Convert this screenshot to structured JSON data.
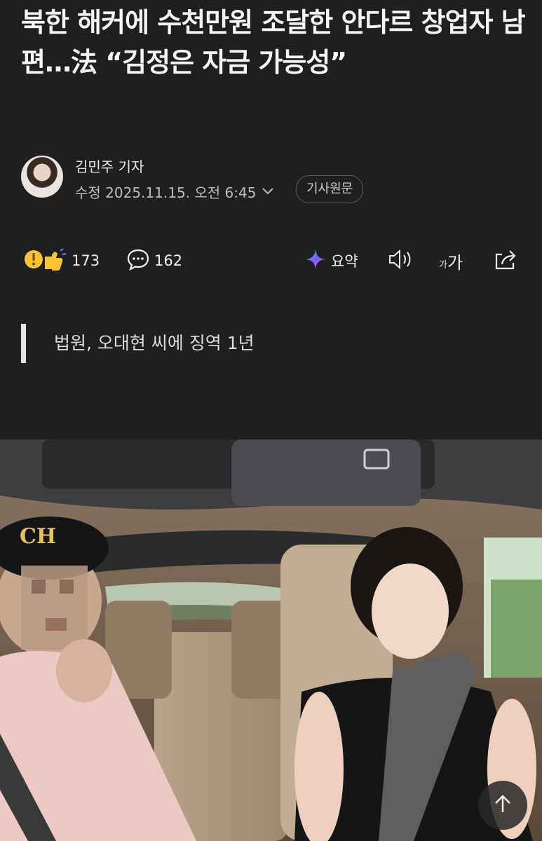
{
  "article": {
    "headline": "북한 해커에 수천만원 조달한 안다르 창업자 남편…法 “김정은 자금 가능성”",
    "subheadline": "법원, 오대현 씨에 징역 1년"
  },
  "byline": {
    "reporter": "김민주 기자",
    "modified": "수정 2025.11.15. 오전 6:45",
    "original_button": "기사원문"
  },
  "toolbar": {
    "reaction_count": "173",
    "comment_count": "162",
    "summary_label": "요약",
    "font_size_label_small": "가",
    "font_size_label_large": "가"
  },
  "icons": {
    "reaction": "reaction-emoji-icon",
    "comment": "comment-bubble-icon",
    "summary": "ai-sparkle-icon",
    "tts": "speaker-icon",
    "share": "share-icon",
    "scroll_top": "arrow-up-icon"
  },
  "colors": {
    "background": "#1f1f1f",
    "summary_accent": "#7b5cff"
  }
}
